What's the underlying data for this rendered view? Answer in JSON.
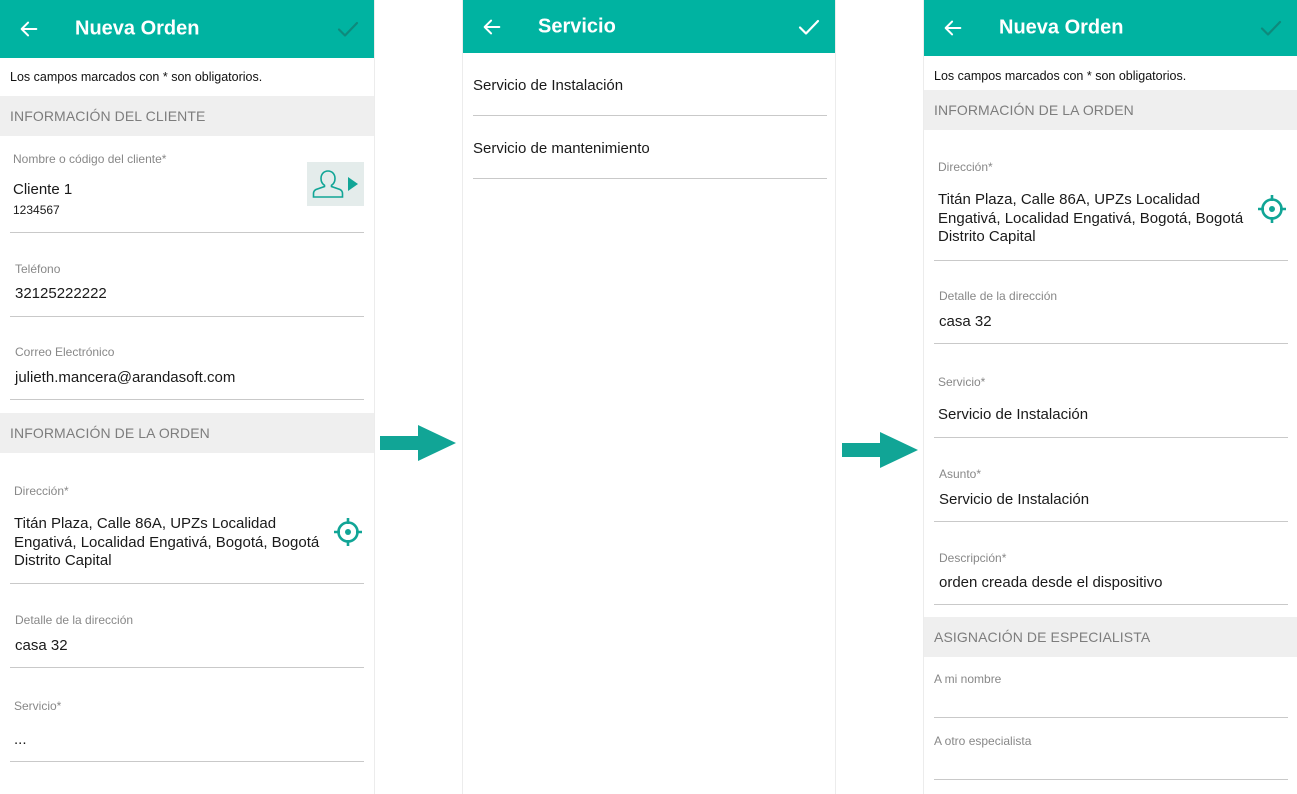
{
  "screen1": {
    "title": "Nueva Orden",
    "note": "Los campos marcados con * son obligatorios.",
    "section_cliente": "INFORMACIÓN DEL CLIENTE",
    "client_label": "Nombre o código del cliente*",
    "client_name": "Cliente 1",
    "client_code": "1234567",
    "phone_label": "Teléfono",
    "phone_value": "32125222222",
    "email_label": "Correo Electrónico",
    "email_value": "julieth.mancera@arandasoft.com",
    "section_orden": "INFORMACIÓN DE LA ORDEN",
    "address_label": "Dirección*",
    "address_line1": "Titán Plaza, Calle 86A, UPZs Localidad",
    "address_line2": "Engativá, Localidad Engativá, Bogotá, Bogotá",
    "address_line3": "Distrito Capital",
    "address_detail_label": "Detalle de la dirección",
    "address_detail_value": "casa 32",
    "service_label": "Servicio*",
    "service_value": "..."
  },
  "screen2": {
    "title": "Servicio",
    "items": [
      {
        "label": "Servicio de Instalación"
      },
      {
        "label": "Servicio de mantenimiento"
      }
    ]
  },
  "screen3": {
    "title": "Nueva Orden",
    "note": "Los campos marcados con * son obligatorios.",
    "section_orden": "INFORMACIÓN DE LA ORDEN",
    "address_label": "Dirección*",
    "address_line1": "Titán Plaza, Calle 86A, UPZs Localidad",
    "address_line2": "Engativá, Localidad Engativá, Bogotá, Bogotá",
    "address_line3": "Distrito Capital",
    "address_detail_label": "Detalle de la dirección",
    "address_detail_value": "casa 32",
    "service_label": "Servicio*",
    "service_value": "Servicio de Instalación",
    "subject_label": "Asunto*",
    "subject_value": "Servicio de Instalación",
    "description_label": "Descripción*",
    "description_value": "orden creada desde el dispositivo",
    "section_asignacion": "ASIGNACIÓN DE ESPECIALISTA",
    "my_name_label": "A mi nombre",
    "other_specialist_label": "A otro especialista"
  },
  "colors": {
    "accent": "#00b3a1",
    "section_bg": "#efefef",
    "section_text": "#7d7d7d",
    "divider": "#c9c9c9"
  },
  "icons": [
    "back-arrow-icon",
    "check-icon",
    "user-icon",
    "play-triangle-icon",
    "crosshair-icon",
    "right-arrow-icon"
  ]
}
